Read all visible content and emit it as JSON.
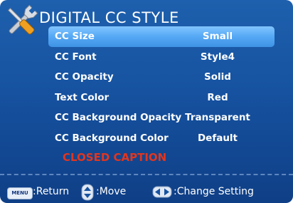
{
  "title": "DIGITAL CC STYLE",
  "menu_items": [
    {
      "label": "CC Size",
      "value": "Small",
      "selected": true
    },
    {
      "label": "CC Font",
      "value": "Style4",
      "selected": false
    },
    {
      "label": "CC Opacity",
      "value": "Solid",
      "selected": false
    },
    {
      "label": "Text Color",
      "value": "Red",
      "selected": false
    },
    {
      "label": "CC Background Opacity",
      "value": "Transparent",
      "selected": false
    },
    {
      "label": "CC Background Color",
      "value": "Default",
      "selected": false
    }
  ],
  "preview_text": "CLOSED CAPTION",
  "footer": {
    "menu_key": "MENU",
    "return_label": ":Return",
    "move_label": ":Move",
    "change_label": ":Change Setting"
  },
  "colors": {
    "background": "#1652a0",
    "highlight": "#55a8f4",
    "preview_text": "#e2351e"
  },
  "icons": {
    "title_icon": "tools-icon",
    "move_icon": "up-down-arrows-icon",
    "change_icon": "left-right-arrows-icon"
  }
}
